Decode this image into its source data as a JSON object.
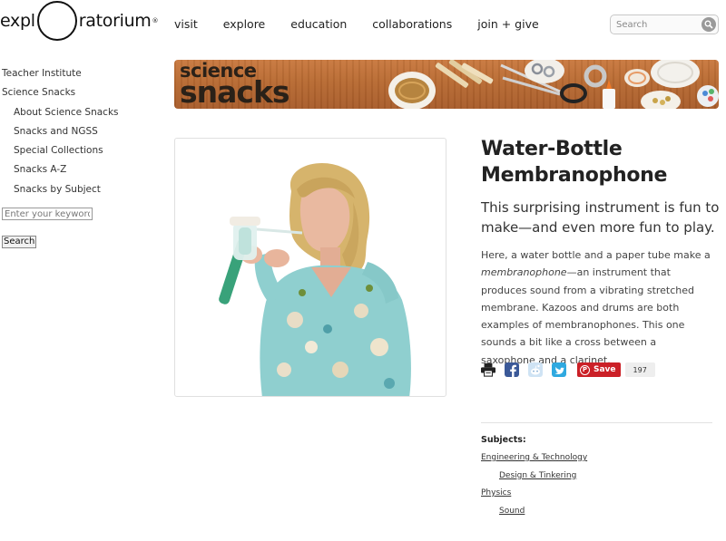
{
  "logo": {
    "left": "expl",
    "right": "ratorium",
    "reg": "®"
  },
  "nav": [
    "visit",
    "explore",
    "education",
    "collaborations",
    "join + give"
  ],
  "search": {
    "placeholder": "Search"
  },
  "sidebar": {
    "items": [
      {
        "label": "Teacher Institute",
        "level": 0
      },
      {
        "label": "Science Snacks",
        "level": 0
      },
      {
        "label": "About Science Snacks",
        "level": 1
      },
      {
        "label": "Snacks and NGSS",
        "level": 1
      },
      {
        "label": "Special Collections",
        "level": 1
      },
      {
        "label": "Snacks A-Z",
        "level": 1
      },
      {
        "label": "Snacks by Subject",
        "level": 1
      }
    ],
    "search_placeholder": "Enter your keywords",
    "search_button": "Search"
  },
  "banner": {
    "line1": "science",
    "line2": "snacks"
  },
  "article": {
    "title": "Water-Bottle Membranophone",
    "subtitle": "This surprising instrument is fun to make—and even more fun to play.",
    "desc_pre": "Here, a water bottle and a paper tube make a ",
    "desc_em": "membranophone",
    "desc_post": "—an instrument that produces sound from a vibrating stretched membrane. Kazoos and drums are both examples of membranophones. This one sounds a bit like a cross between a saxophone and a clarinet."
  },
  "share": {
    "icons": [
      "print-icon",
      "facebook-icon",
      "reddit-icon",
      "twitter-icon"
    ],
    "pin_label": "Save",
    "pin_count": "197",
    "colors": {
      "pinterest": "#cb2027",
      "facebook": "#3b5998",
      "twitter": "#2fa9e0",
      "reddit": "#b9d4ec"
    }
  },
  "subjects": {
    "heading": "Subjects:",
    "items": [
      {
        "label": "Engineering & Technology",
        "level": 0
      },
      {
        "label": "Design & Tinkering",
        "level": 1
      },
      {
        "label": "Physics",
        "level": 0
      },
      {
        "label": "Sound",
        "level": 1
      }
    ]
  }
}
